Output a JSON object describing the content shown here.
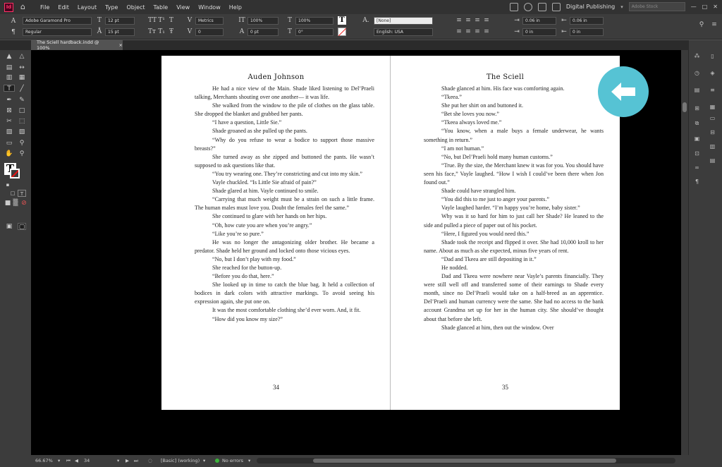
{
  "app": {
    "logo": "Id"
  },
  "menu": [
    "File",
    "Edit",
    "Layout",
    "Type",
    "Object",
    "Table",
    "View",
    "Window",
    "Help"
  ],
  "menubar_right": {
    "workspace": "Digital Publishing",
    "stock_placeholder": "Adobe Stock"
  },
  "control": {
    "font_family": "Adobe Garamond Pro",
    "font_style": "Regular",
    "font_size": "12 pt",
    "leading": "15 pt",
    "kerning": "Metrics",
    "tracking": "0",
    "vscale": "100%",
    "hscale": "100%",
    "baseline": "0 pt",
    "skew": "0°",
    "char_style": "[None]",
    "language": "English: USA",
    "indent_left": "0.06 in",
    "indent_right": "0.06 in",
    "space_before": "0 in",
    "space_after": "0 in"
  },
  "tab": {
    "title": "The Sciell hardback.indd @ 100%",
    "close": "×"
  },
  "pages": {
    "left": {
      "header": "Auden Johnson",
      "folio": "34",
      "paragraphs": [
        {
          "indent": true,
          "text": "He had a nice view of the Main. Shade liked listening to Del’Praeli talking, Merchants shouting over one another— it was life."
        },
        {
          "indent": true,
          "text": "She walked from the window to the pile of clothes on the glass table. She dropped the blanket and grabbed her pants."
        },
        {
          "indent": true,
          "text": "“I have a question, Little Sie.”"
        },
        {
          "indent": true,
          "text": "Shade groaned as she pulled up the pants."
        },
        {
          "indent": true,
          "text": "“Why do you refuse to wear a bodice to support those massive breasts?”"
        },
        {
          "indent": true,
          "text": "She turned away as she zipped and buttoned the pants. He wasn’t supposed to ask questions like that."
        },
        {
          "indent": true,
          "text": "“You try wearing one. They’re constricting and cut into my skin.”"
        },
        {
          "indent": true,
          "text": "Vayle chuckled. “Is Little Sie afraid of pain?”"
        },
        {
          "indent": true,
          "text": "Shade glared at him. Vayle continued to smile."
        },
        {
          "indent": true,
          "text": "“Carrying that much weight must be a strain on such a little frame. The human males must love you. Doubt the females feel the same.”"
        },
        {
          "indent": true,
          "text": "She continued to glare with her hands on her hips."
        },
        {
          "indent": true,
          "text": "“Oh, how cute you are when you’re angry.”"
        },
        {
          "indent": true,
          "text": "“Like you’re so pure.”"
        },
        {
          "indent": true,
          "text": "He was no longer the antagonizing older brother. He became a predator. Shade held her ground and locked onto those vicious eyes."
        },
        {
          "indent": true,
          "text": "“No, but I don’t play with my food.”"
        },
        {
          "indent": true,
          "text": "She reached for the button-up."
        },
        {
          "indent": true,
          "text": "“Before you do that, here.”"
        },
        {
          "indent": true,
          "text": "She looked up in time to catch the blue bag. It held a collection of bodices in dark colors with attractive markings. To avoid seeing his expression again, she put one on."
        },
        {
          "indent": true,
          "text": "It was the most comfortable clothing she’d ever worn. And, it fit."
        },
        {
          "indent": true,
          "text": "“How did you know my size?”"
        }
      ]
    },
    "right": {
      "header": "The Sciell",
      "folio": "35",
      "paragraphs": [
        {
          "indent": true,
          "text": "Shade glanced at him. His face was comforting again."
        },
        {
          "indent": true,
          "text": "“Tkeea.”"
        },
        {
          "indent": true,
          "text": "She put her shirt on and buttoned it."
        },
        {
          "indent": true,
          "text": "“Bet she loves you now.”"
        },
        {
          "indent": true,
          "text": "“Tkeea always loved me.”"
        },
        {
          "indent": true,
          "text": "“You know, when a male buys a female underwear, he wants something in return.”"
        },
        {
          "indent": true,
          "text": "“I am not human.”"
        },
        {
          "indent": true,
          "text": "“No, but Del’Praeli hold many human customs.”"
        },
        {
          "indent": true,
          "text": "“True. By the size, the Merchant knew it was for you. You should have seen his face,” Vayle laughed. “How I wish I could’ve been there when Jon found out.”"
        },
        {
          "indent": true,
          "text": "Shade could have strangled him."
        },
        {
          "indent": true,
          "text": "“You did this to me just to anger your parents.”"
        },
        {
          "indent": true,
          "text": "Vayle laughed harder. “I’m happy you’re home, baby sister.”"
        },
        {
          "indent": true,
          "text": "Why was it so hard for him to just call her Shade? He leaned to the side and pulled a piece of paper out of his pocket."
        },
        {
          "indent": true,
          "text": "“Here, I figured you would need this.”"
        },
        {
          "indent": true,
          "text": "Shade took the receipt and flipped it over. She had 10,000 kroll to her name. About as much as she expected, minus five years of rent."
        },
        {
          "indent": true,
          "text": "“Dad and Tkeea are still depositing in it.”"
        },
        {
          "indent": true,
          "text": "He nodded."
        },
        {
          "indent": true,
          "text": "Dad and Tkeea were nowhere near Vayle’s parents financially. They were still well off and transferred some of their earnings to Shade every month, since no Del’Praeli would take on a half-breed as an apprentice. Del’Praeli and human currency were the same. She had no access to the bank account Grandma set up for her in the human city. She should’ve thought about that before she left."
        },
        {
          "indent": true,
          "text": "Shade glanced at him, then out the window. Over"
        }
      ]
    }
  },
  "status": {
    "zoom": "66.67%",
    "page": "34",
    "style": "[Basic] (working)",
    "preflight": "No errors"
  },
  "colors": {
    "accent": "#56c3d4",
    "indesign": "#ff3366",
    "pasteboard": "#000000"
  },
  "icons": [
    "home-icon",
    "back-arrow-icon",
    "type-tool-icon",
    "selection-tool-icon",
    "fill-stroke-icon"
  ]
}
